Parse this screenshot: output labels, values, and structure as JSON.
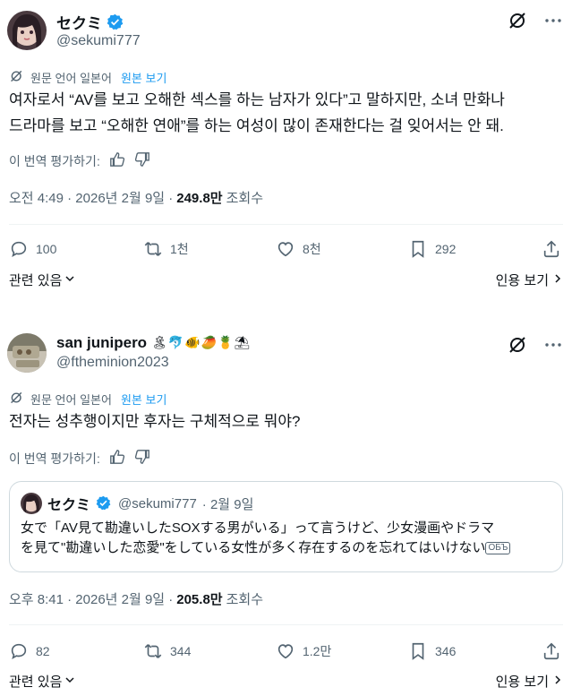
{
  "post1": {
    "display_name": "セクミ",
    "handle": "@sekumi777",
    "translated_from": "원문 언어 일본어",
    "show_original": "원본 보기",
    "text_line1": "여자로서 “AV를 보고 오해한 섹스를 하는 남자가 있다”고 말하지만, 소녀 만화나",
    "text_line2": "드라마를 보고 “오해한 연애”를 하는 여성이 많이 존재한다는 걸 잊어서는 안 돼.",
    "rate_label": "이 번역 평가하기:",
    "timestamp": "오전 4:49 · 2026년 2월 9일 ·",
    "views": "249.8만",
    "views_label": "조회수",
    "replies": "100",
    "reposts": "1천",
    "likes": "8천",
    "bookmarks": "292",
    "related_label": "관련 있음",
    "quotes_label": "인용 보기"
  },
  "post2": {
    "display_name": "san junipero",
    "emojis": "🏝🐬🐠🥭🍍⛱",
    "handle": "@ftheminion2023",
    "translated_from": "원문 언어 일본어",
    "show_original": "원본 보기",
    "text_line1": "전자는 성추행이지만 후자는 구체적으로 뭐야?",
    "rate_label": "이 번역 평가하기:",
    "quoted": {
      "display_name": "セクミ",
      "handle": "@sekumi777",
      "dot_date": "· 2월 9일",
      "text_line1": "女で「AV見て勘違いしたSOXする男がいる」って言うけど、少女漫画やドラマ",
      "text_line2": "を見て\"勘違いした恋愛\"をしている女性が多く存在するのを忘れてはいけない",
      "more_badge": "ОБЪ"
    },
    "timestamp": "오후 8:41 · 2026년 2월 9일 ·",
    "views": "205.8만",
    "views_label": "조회수",
    "replies": "82",
    "reposts": "344",
    "likes": "1.2만",
    "bookmarks": "346",
    "related_label": "관련 있음",
    "quotes_label": "인용 보기"
  },
  "colors": {
    "text": "#0f1419",
    "secondary": "#536471",
    "accent": "#1d9bf0",
    "border": "#cfd9de"
  }
}
